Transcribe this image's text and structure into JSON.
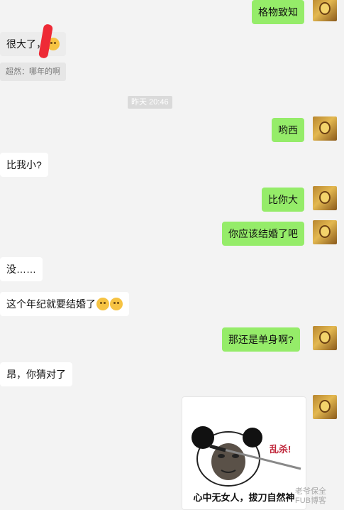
{
  "messages": {
    "m1": "格物致知",
    "m2": "很大了，",
    "m2_quote": "超然：哪年的啊",
    "time": "昨天 20:46",
    "m3": "哟西",
    "m4": "比我小?",
    "m5": "比你大",
    "m6": "你应该结婚了吧",
    "m7": "没……",
    "m8": "这个年纪就要结婚了",
    "m9": "那还是单身啊?",
    "m10": "昂，你猜对了"
  },
  "sticker": {
    "caption": "心中无女人，拔刀自然神",
    "tag": "乱杀!"
  },
  "watermark": {
    "line1": "老爷保全",
    "line2": "FUB博客"
  },
  "colors": {
    "background": "#f3f3f3",
    "incoming_bubble": "#ffffff",
    "outgoing_bubble": "#95ec69"
  }
}
